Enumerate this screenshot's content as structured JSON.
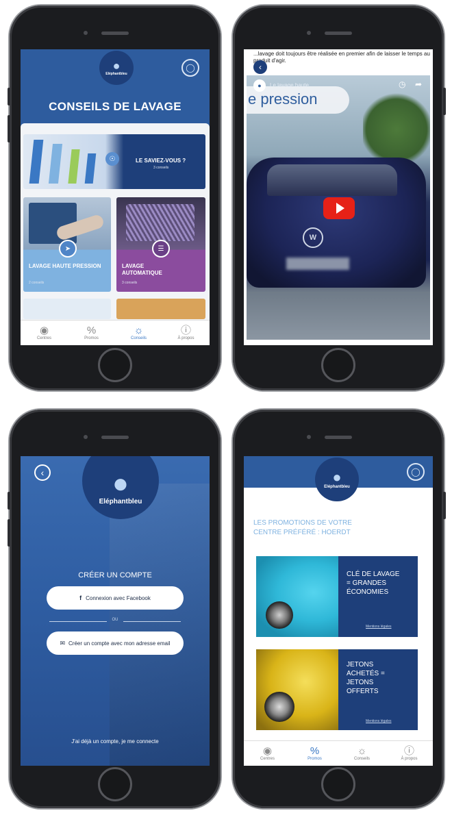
{
  "phone1": {
    "logo_text": "Eléphantbleu",
    "page_title": "CONSEILS DE LAVAGE",
    "cards": [
      {
        "title": "LE SAVIEZ-VOUS ?",
        "subtitle": "3 conseils"
      },
      {
        "title": "LAVAGE HAUTE PRESSION",
        "subtitle": "2 conseils"
      },
      {
        "title": "LAVAGE AUTOMATIQUE",
        "subtitle": "3 conseils"
      }
    ],
    "tabs": [
      {
        "label": "Centres",
        "icon": "badge-icon"
      },
      {
        "label": "Promos",
        "icon": "percent-icon"
      },
      {
        "label": "Conseils",
        "icon": "lightbulb-icon"
      },
      {
        "label": "À propos",
        "icon": "info-icon"
      }
    ]
  },
  "phone2": {
    "intro_text": "...lavage doit toujours être réalisée en premier afin de laisser le temps au produit d'agir.",
    "video_overlay": "e pression",
    "video_title": "Le lavage haute"
  },
  "phone3": {
    "logo_text": "Eléphantbleu",
    "create_title": "CRÉER UN COMPTE",
    "facebook_button": "Connexion avec Facebook",
    "or_label": "OU",
    "email_button": "Créer un compte avec mon adresse email",
    "login_link": "J'ai déjà un compte, je me connecte"
  },
  "phone4": {
    "logo_text": "Eléphantbleu",
    "promo_title_line1": "LES PROMOTIONS DE VOTRE",
    "promo_title_line2": "CENTRE PRÉFÉRÉ : HOERDT",
    "promos": [
      {
        "title_lines": [
          "CLÉ DE LAVAGE",
          "= GRANDES",
          "ÉCONOMIES"
        ],
        "link": "Mentions légales"
      },
      {
        "title_lines": [
          "JETONS",
          "ACHETÉS =",
          "JETONS",
          "OFFERTS"
        ],
        "link": "Mentions légales"
      }
    ],
    "tabs": [
      {
        "label": "Centres",
        "icon": "badge-icon"
      },
      {
        "label": "Promos",
        "icon": "percent-icon"
      },
      {
        "label": "Conseils",
        "icon": "lightbulb-icon"
      },
      {
        "label": "À propos",
        "icon": "info-icon"
      }
    ]
  },
  "colors": {
    "brand_navy": "#1e3f7a",
    "header_blue": "#2e5c9e",
    "accent_blue": "#3a78c4",
    "purple": "#8b4c9e",
    "light_blue": "#7fb2e0",
    "youtube_red": "#e62117"
  }
}
